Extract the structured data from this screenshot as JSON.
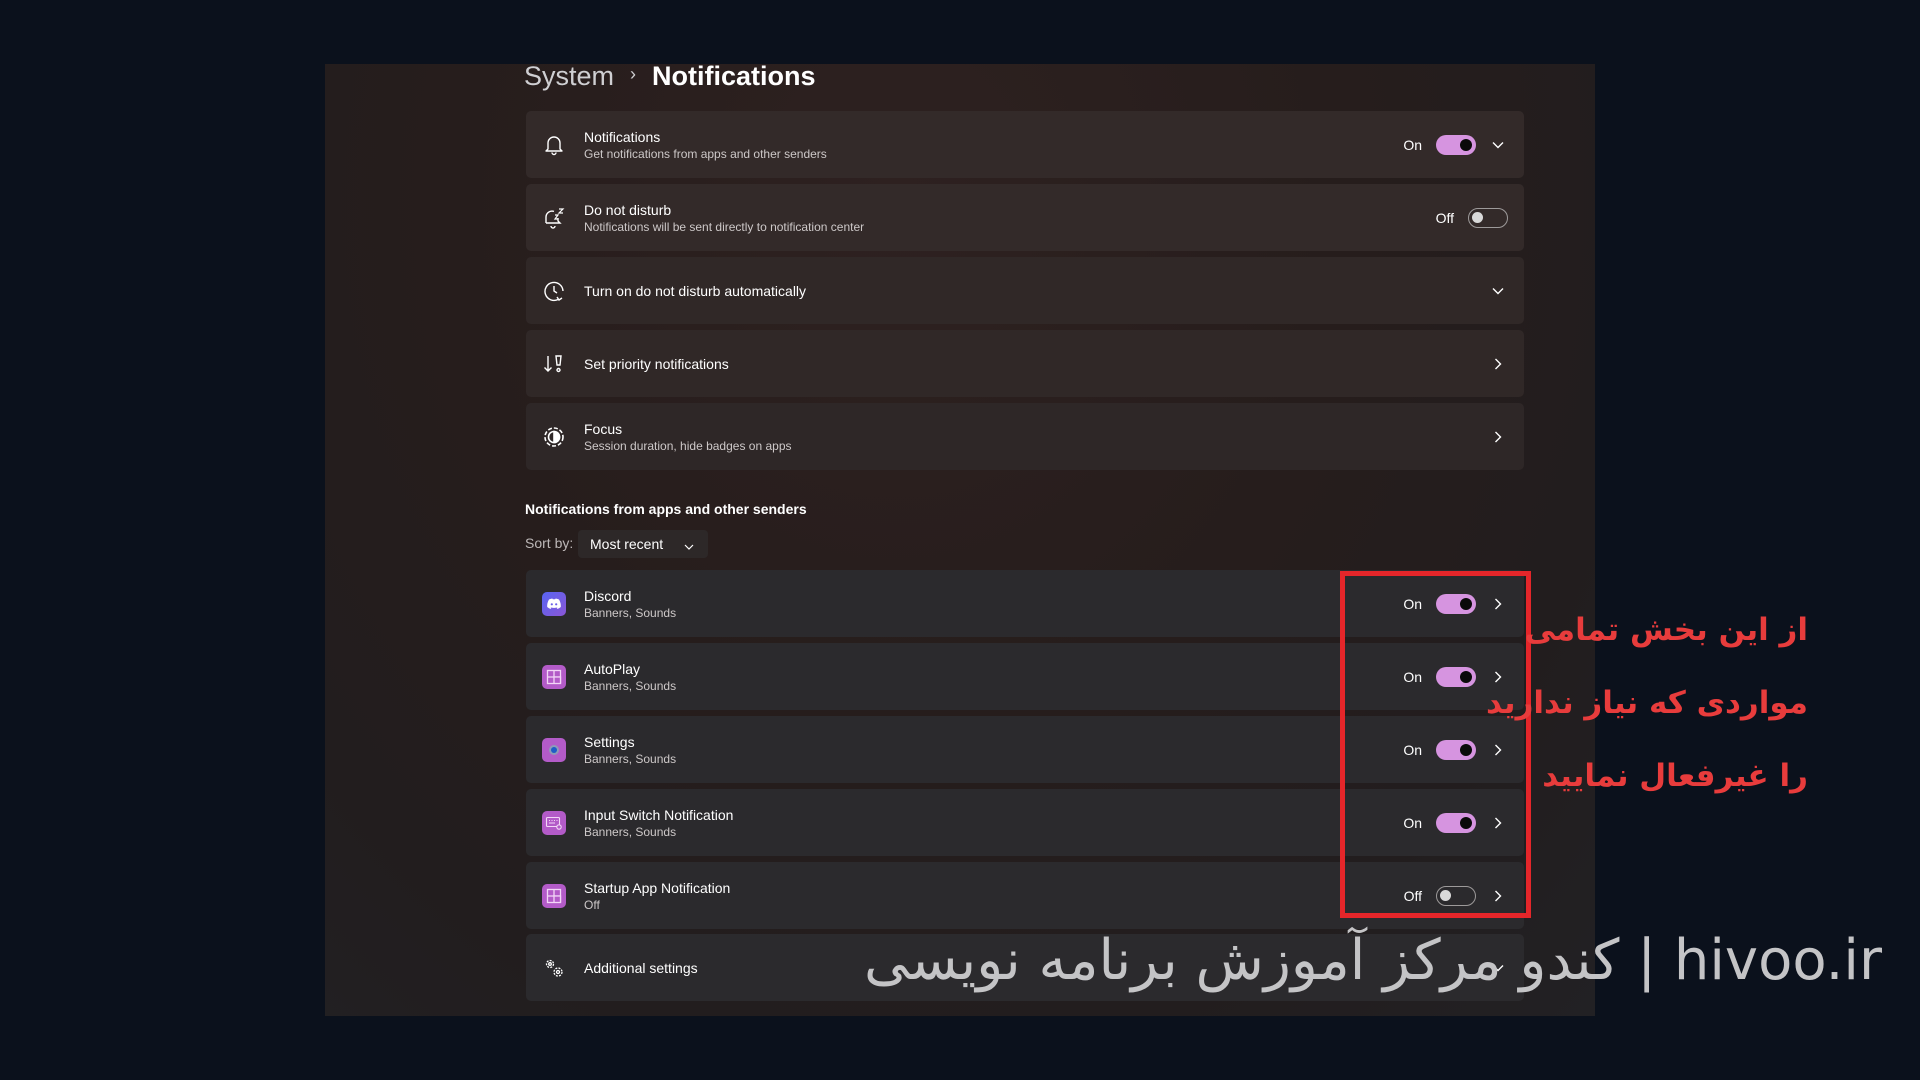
{
  "breadcrumb": {
    "parent": "System",
    "separator": "›",
    "current": "Notifications"
  },
  "top_settings": [
    {
      "icon": "bell-icon",
      "title": "Notifications",
      "subtitle": "Get notifications from apps and other senders",
      "state_label": "On",
      "toggle": "on",
      "trailing": "chevron-down-icon"
    },
    {
      "icon": "bell-snooze-icon",
      "title": "Do not disturb",
      "subtitle": "Notifications will be sent directly to notification center",
      "state_label": "Off",
      "toggle": "off",
      "trailing": ""
    },
    {
      "icon": "clock-refresh-icon",
      "title": "Turn on do not disturb automatically",
      "subtitle": "",
      "state_label": "",
      "toggle": "",
      "trailing": "chevron-down-icon"
    },
    {
      "icon": "priority-icon",
      "title": "Set priority notifications",
      "subtitle": "",
      "state_label": "",
      "toggle": "",
      "trailing": "chevron-right-icon"
    },
    {
      "icon": "focus-icon",
      "title": "Focus",
      "subtitle": "Session duration, hide badges on apps",
      "state_label": "",
      "toggle": "",
      "trailing": "chevron-right-icon"
    }
  ],
  "apps_section": {
    "title": "Notifications from apps and other senders",
    "sort_label": "Sort by:",
    "sort_value": "Most recent",
    "apps": [
      {
        "icon": "discord-icon",
        "name": "Discord",
        "subtitle": "Banners, Sounds",
        "state_label": "On",
        "toggle": "on"
      },
      {
        "icon": "autoplay-icon",
        "name": "AutoPlay",
        "subtitle": "Banners, Sounds",
        "state_label": "On",
        "toggle": "on"
      },
      {
        "icon": "settings-app-icon",
        "name": "Settings",
        "subtitle": "Banners, Sounds",
        "state_label": "On",
        "toggle": "on"
      },
      {
        "icon": "input-switch-icon",
        "name": "Input Switch Notification",
        "subtitle": "Banners, Sounds",
        "state_label": "On",
        "toggle": "on"
      },
      {
        "icon": "startup-app-icon",
        "name": "Startup App Notification",
        "subtitle": "Off",
        "state_label": "Off",
        "toggle": "off"
      }
    ]
  },
  "additional_settings": {
    "icon": "gears-icon",
    "title": "Additional settings"
  },
  "annotation": {
    "lines": [
      "از این بخش تمامی",
      "مواردی که نیاز ندارید",
      "را غیرفعال نمایید"
    ],
    "color": "#e5262a"
  },
  "watermark": "کندو مرکز آموزش برنامه نویسی | hivoo.ir",
  "colors": {
    "toggle_on": "#d694e0",
    "app_icon_purple": "#b35bc8",
    "discord_blue": "#5865f2",
    "highlight_red": "#e5262a"
  }
}
